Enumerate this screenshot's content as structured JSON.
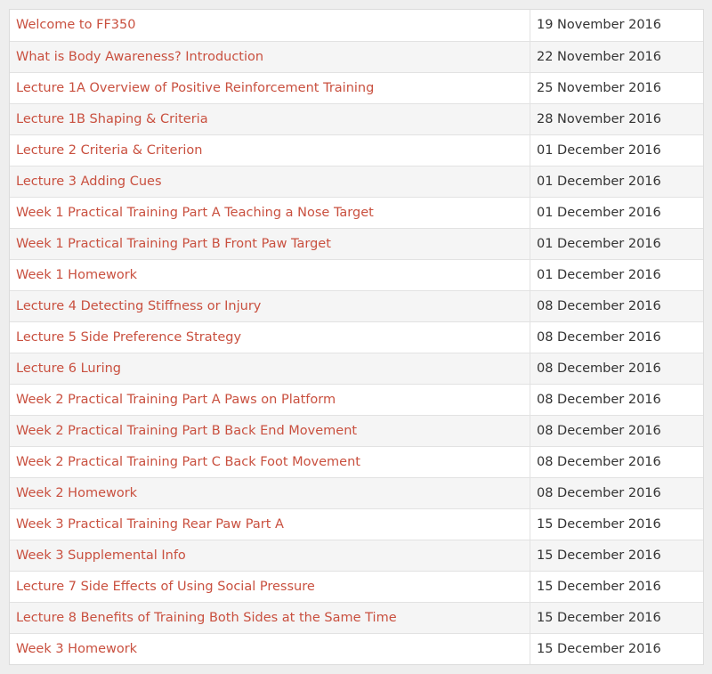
{
  "lessons": [
    {
      "title": "Welcome to FF350",
      "date": "19 November 2016"
    },
    {
      "title": "What is Body Awareness? Introduction",
      "date": "22 November 2016"
    },
    {
      "title": "Lecture 1A Overview of Positive Reinforcement Training",
      "date": "25 November 2016"
    },
    {
      "title": "Lecture 1B Shaping & Criteria",
      "date": "28 November 2016"
    },
    {
      "title": "Lecture 2 Criteria & Criterion",
      "date": "01 December 2016"
    },
    {
      "title": "Lecture 3 Adding Cues",
      "date": "01 December 2016"
    },
    {
      "title": "Week 1 Practical Training Part A Teaching a Nose Target",
      "date": "01 December 2016"
    },
    {
      "title": "Week 1 Practical Training Part B Front Paw Target",
      "date": "01 December 2016"
    },
    {
      "title": "Week 1 Homework",
      "date": "01 December 2016"
    },
    {
      "title": "Lecture 4 Detecting Stiffness or Injury",
      "date": "08 December 2016"
    },
    {
      "title": "Lecture 5 Side Preference Strategy",
      "date": "08 December 2016"
    },
    {
      "title": "Lecture 6 Luring",
      "date": "08 December 2016"
    },
    {
      "title": "Week 2 Practical Training Part A Paws on Platform",
      "date": "08 December 2016"
    },
    {
      "title": "Week 2 Practical Training Part B Back End Movement",
      "date": "08 December 2016"
    },
    {
      "title": "Week 2 Practical Training Part C Back Foot Movement",
      "date": "08 December 2016"
    },
    {
      "title": "Week 2 Homework",
      "date": "08 December 2016"
    },
    {
      "title": "Week 3 Practical Training Rear Paw Part A",
      "date": "15 December 2016"
    },
    {
      "title": "Week 3 Supplemental Info",
      "date": "15 December 2016"
    },
    {
      "title": "Lecture 7 Side Effects of Using Social Pressure",
      "date": "15 December 2016"
    },
    {
      "title": "Lecture 8 Benefits of Training Both Sides at the Same Time",
      "date": "15 December 2016"
    },
    {
      "title": "Week 3 Homework",
      "date": "15 December 2016"
    }
  ],
  "colors": {
    "link": "#c9503f",
    "text": "#333333",
    "row_alt": "#f5f5f5",
    "page_bg": "#eeeeee"
  }
}
